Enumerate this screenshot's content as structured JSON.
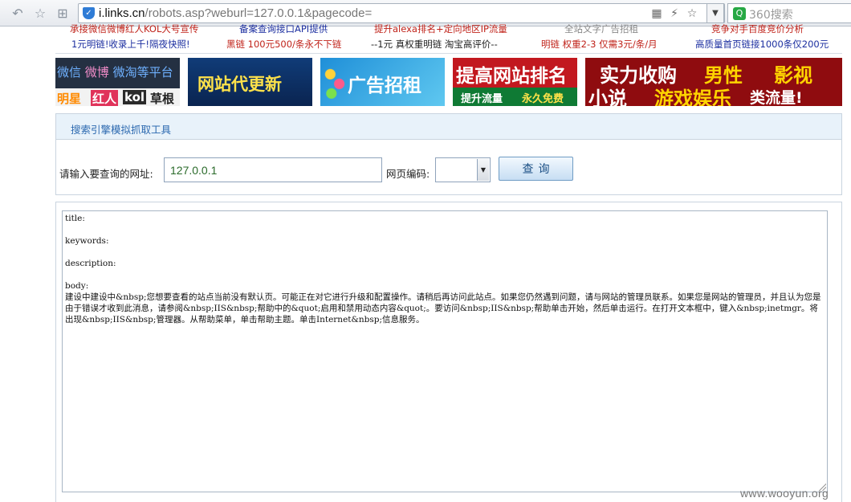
{
  "browser": {
    "url_host": "i.links.cn",
    "url_path": "/robots.asp?weburl=127.0.0.1&pagecode=",
    "search_placeholder": "360搜索"
  },
  "ad_links": {
    "row1": [
      "承接微信微博红人KOL大号宣传",
      "备案查询接口API提供",
      "提升alexa排名+定向地区IP流量",
      "全站文字广告招租",
      "竞争对手百度竞价分析"
    ],
    "row2": [
      "1元明链!收录上千!隔夜快照!",
      "黑链 100元500/条永不下链",
      "--1元 真权重明链 淘宝高评价--",
      "明链 权重2-3 仅需3元/条/月",
      "高质量首页链接1000条仅200元"
    ]
  },
  "banners": {
    "b1_line1": [
      "微信",
      "微博",
      "微淘等平台"
    ],
    "b1_line2": [
      "明星",
      "红人",
      "kol",
      "草根"
    ],
    "b2": "网站代更新",
    "b3": "广告招租",
    "b4_title": "提高网站排名",
    "b4_sub": [
      "提升流量",
      "永久免费"
    ],
    "b5_line1": [
      "实力收购",
      "男性",
      "影视"
    ],
    "b5_line2": [
      "小说",
      "游戏娱乐",
      "类流量!"
    ]
  },
  "tool": {
    "title": "搜索引擎模拟抓取工具",
    "url_label": "请输入要查询的网址:",
    "url_value": "127.0.0.1",
    "encoding_label": "网页编码:",
    "encoding_value": "",
    "query_button": "查询"
  },
  "result": {
    "lines": [
      "title:",
      "",
      "keywords:",
      "",
      "description:",
      "",
      "body:",
      "建设中建设中&nbsp;您想要查看的站点当前没有默认页。可能正在对它进行升级和配置操作。请稍后再访问此站点。如果您仍然遇到问题，请与网站的管理员联系。如果您是网站的管理员，并且认为您是由于错误才收到此消息，请参阅&nbsp;IIS&nbsp;帮助中的&quot;启用和禁用动态内容&quot;。要访问&nbsp;IIS&nbsp;帮助单击开始，然后单击运行。在打开文本框中，键入&nbsp;inetmgr。将出现&nbsp;IIS&nbsp;管理器。从帮助菜单，单击帮助主题。单击Internet&nbsp;信息服务。"
    ]
  },
  "watermark": "www.wooyun.org"
}
